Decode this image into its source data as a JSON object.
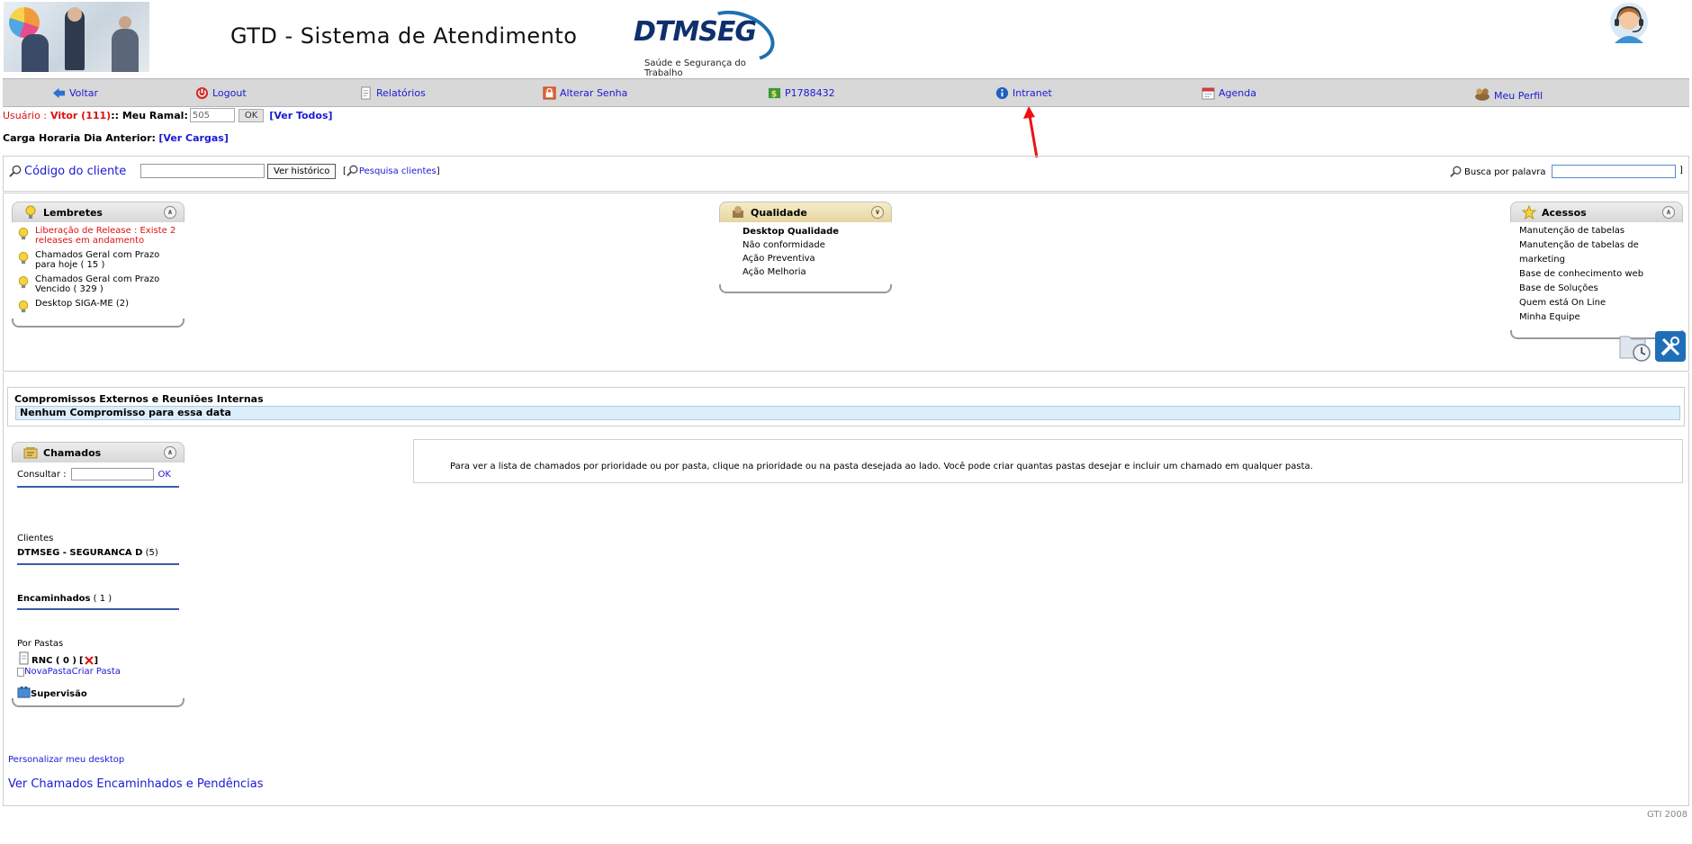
{
  "header": {
    "app_title": "GTD - Sistema de Atendimento",
    "logo_brand": "DTMSEG",
    "logo_tagline": "Saúde e Segurança do Trabalho"
  },
  "nav": {
    "items": [
      {
        "label": "Voltar",
        "icon": "back-arrow-icon"
      },
      {
        "label": "Logout",
        "icon": "logout-icon"
      },
      {
        "label": "Relatórios",
        "icon": "report-icon"
      },
      {
        "label": "Alterar Senha",
        "icon": "password-icon"
      },
      {
        "label": "P1788432",
        "icon": "money-icon"
      },
      {
        "label": "Intranet",
        "icon": "info-icon"
      },
      {
        "label": "Agenda",
        "icon": "calendar-icon"
      },
      {
        "label": "Meu Perfil",
        "icon": "profile-icon"
      }
    ]
  },
  "user": {
    "user_label": "Usuário :",
    "user_name": "Vitor (111)",
    "ramal_label": ":: Meu Ramal:",
    "ramal_value": "505",
    "ok_label": "OK",
    "ver_todos": "[Ver Todos]",
    "carga_label": "Carga Horaria Dia Anterior:",
    "ver_cargas": "[Ver Cargas]"
  },
  "search": {
    "client_code_label": "Código do cliente",
    "client_code_value": "",
    "history_button": "Ver histórico",
    "search_clients_open": "[",
    "search_clients": "Pesquisa clientes",
    "search_clients_close": "]",
    "word_search_label": "Busca por palavra",
    "word_search_value": "",
    "word_search_close": "]"
  },
  "lembretes": {
    "title": "Lembretes",
    "items": [
      {
        "text": "Liberação de Release : Existe 2 releases em andamento",
        "color": "#e01010"
      },
      {
        "text": "Chamados Geral com Prazo para hoje ( 15 )",
        "color": "#000000"
      },
      {
        "text": "Chamados Geral com Prazo Vencido ( 329 )",
        "color": "#000000"
      },
      {
        "text": "Desktop SIGA-ME (2)",
        "color": "#000000"
      }
    ]
  },
  "qualidade": {
    "title": "Qualidade",
    "items": [
      "Desktop Qualidade",
      "Não conformidade",
      "Ação Preventiva",
      "Ação Melhoria"
    ]
  },
  "acessos": {
    "title": "Acessos",
    "items": [
      "Manutenção de tabelas",
      "Manutenção de tabelas de marketing",
      "Base de conhecimento web",
      "Base de Soluções",
      "Quem está On Line",
      "Minha Equipe"
    ]
  },
  "compromissos": {
    "title": "Compromissos Externos e Reuniões Internas",
    "empty_text": "Nenhum Compromisso para essa data"
  },
  "chamados": {
    "title": "Chamados",
    "consultar_label": "Consultar :",
    "consultar_value": "",
    "ok_label": "OK",
    "clientes_label": "Clientes",
    "cliente_name": "DTMSEG - SEGURANCA D",
    "cliente_count": "(5)",
    "encaminhados_label": "Encaminhados",
    "encaminhados_count": "( 1 )",
    "por_pastas_label": "Por Pastas",
    "rnc_label": "RNC ( 0 )",
    "rnc_open": "[",
    "rnc_close": "]",
    "nova_pasta_alt": "NovaPasta",
    "criar_pasta": "Criar Pasta",
    "supervisao": "Supervisão"
  },
  "info": {
    "text": "Para ver a lista de chamados por prioridade ou por pasta, clique na prioridade ou na pasta desejada ao lado. Você pode criar quantas pastas desejar e incluir um chamado em qualquer pasta."
  },
  "footer": {
    "personalizar": "Personalizar meu desktop",
    "ver_chamados": "Ver Chamados Encaminhados e Pendências",
    "copyright": "GTI 2008"
  },
  "colors": {
    "link": "#1a1ad6",
    "alert": "#e01010",
    "nav_bg": "#d8d8d8",
    "annotation_arrow": "#ee1111"
  }
}
